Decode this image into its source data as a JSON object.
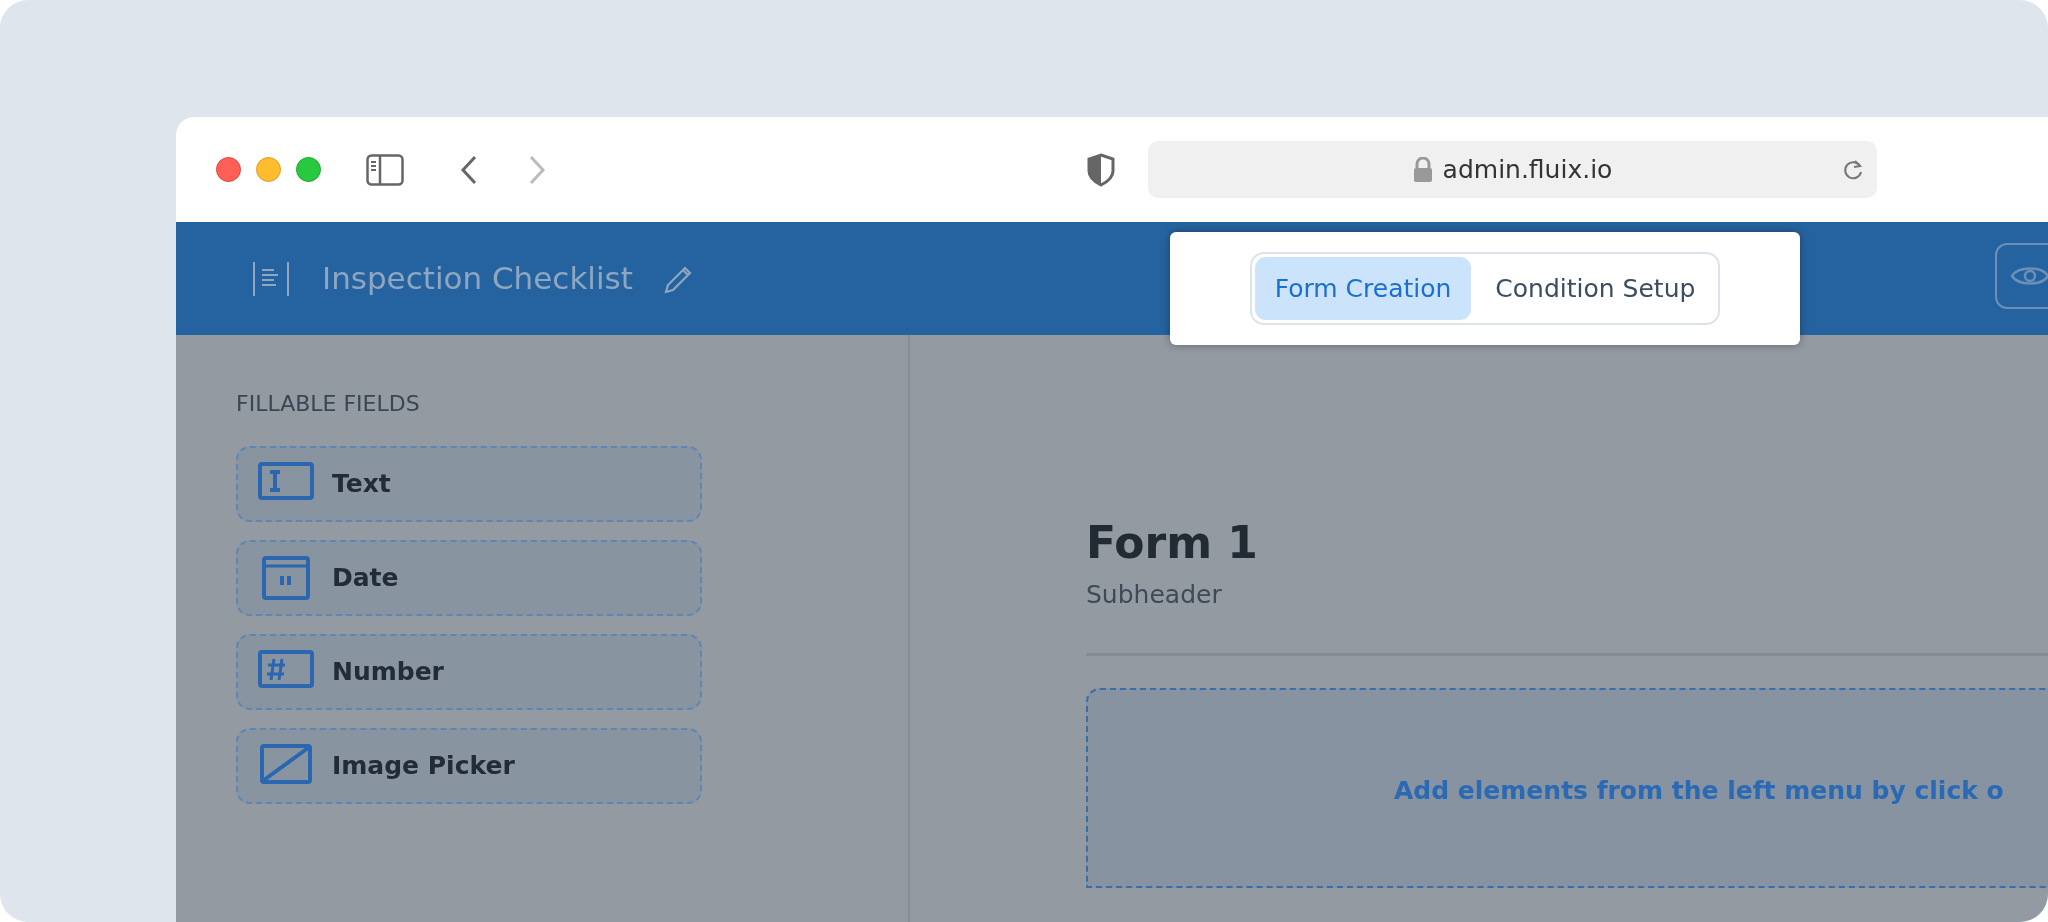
{
  "browser": {
    "url": "admin.fluix.io"
  },
  "header": {
    "title": "Inspection Checklist"
  },
  "mode_tabs": [
    {
      "label": "Form Creation",
      "selected": true
    },
    {
      "label": "Condition Setup",
      "selected": false
    }
  ],
  "sidebar": {
    "section_title": "FILLABLE FIELDS",
    "items": [
      {
        "label": "Text",
        "kind": "text"
      },
      {
        "label": "Date",
        "kind": "date"
      },
      {
        "label": "Number",
        "kind": "number"
      },
      {
        "label": "Image Picker",
        "kind": "image"
      }
    ]
  },
  "form": {
    "title": "Form 1",
    "subheader": "Subheader",
    "dropzone_hint": "Add elements from the left menu by click o"
  }
}
